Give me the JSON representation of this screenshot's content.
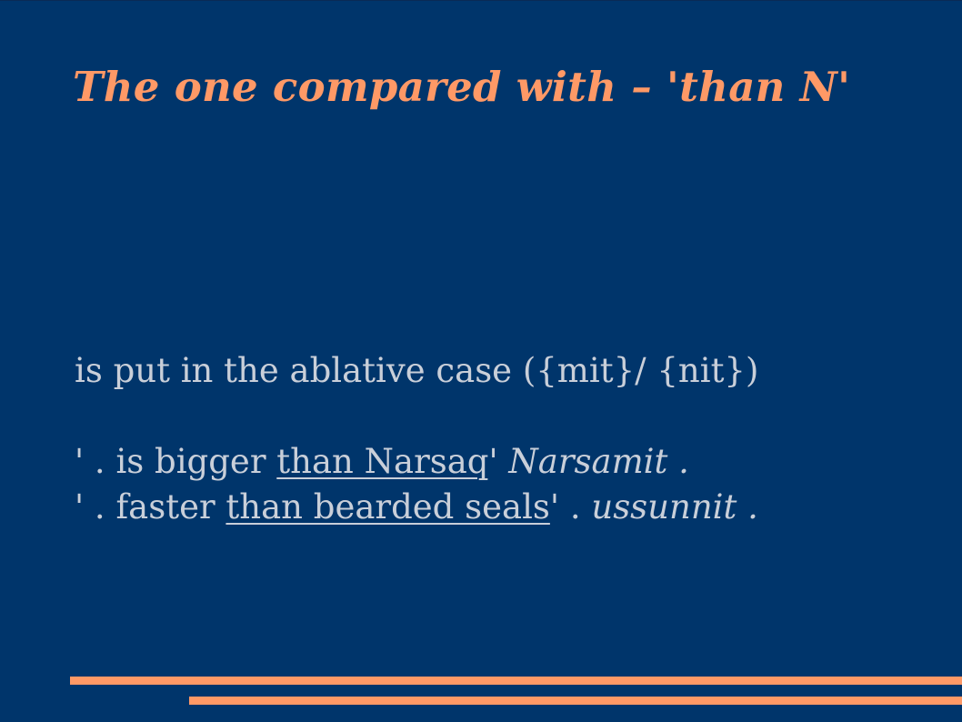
{
  "slide": {
    "title": "The one compared with – 'than N'",
    "intro": "is put in the ablative case ({mit}/ {nit})",
    "examples": [
      {
        "prefix": "' . is bigger ",
        "underlined": "than Narsaq",
        "middle": "' ",
        "italic": "Narsamit .",
        "suffix": ""
      },
      {
        "prefix": "' . faster ",
        "underlined": "than bearded seals",
        "middle": "' . ",
        "italic": "ussunnit .",
        "suffix": ""
      }
    ]
  },
  "colors": {
    "background": "#00356b",
    "title": "#ff9966",
    "body_text": "#c9cfd9",
    "accent_bars": "#ff9966"
  }
}
